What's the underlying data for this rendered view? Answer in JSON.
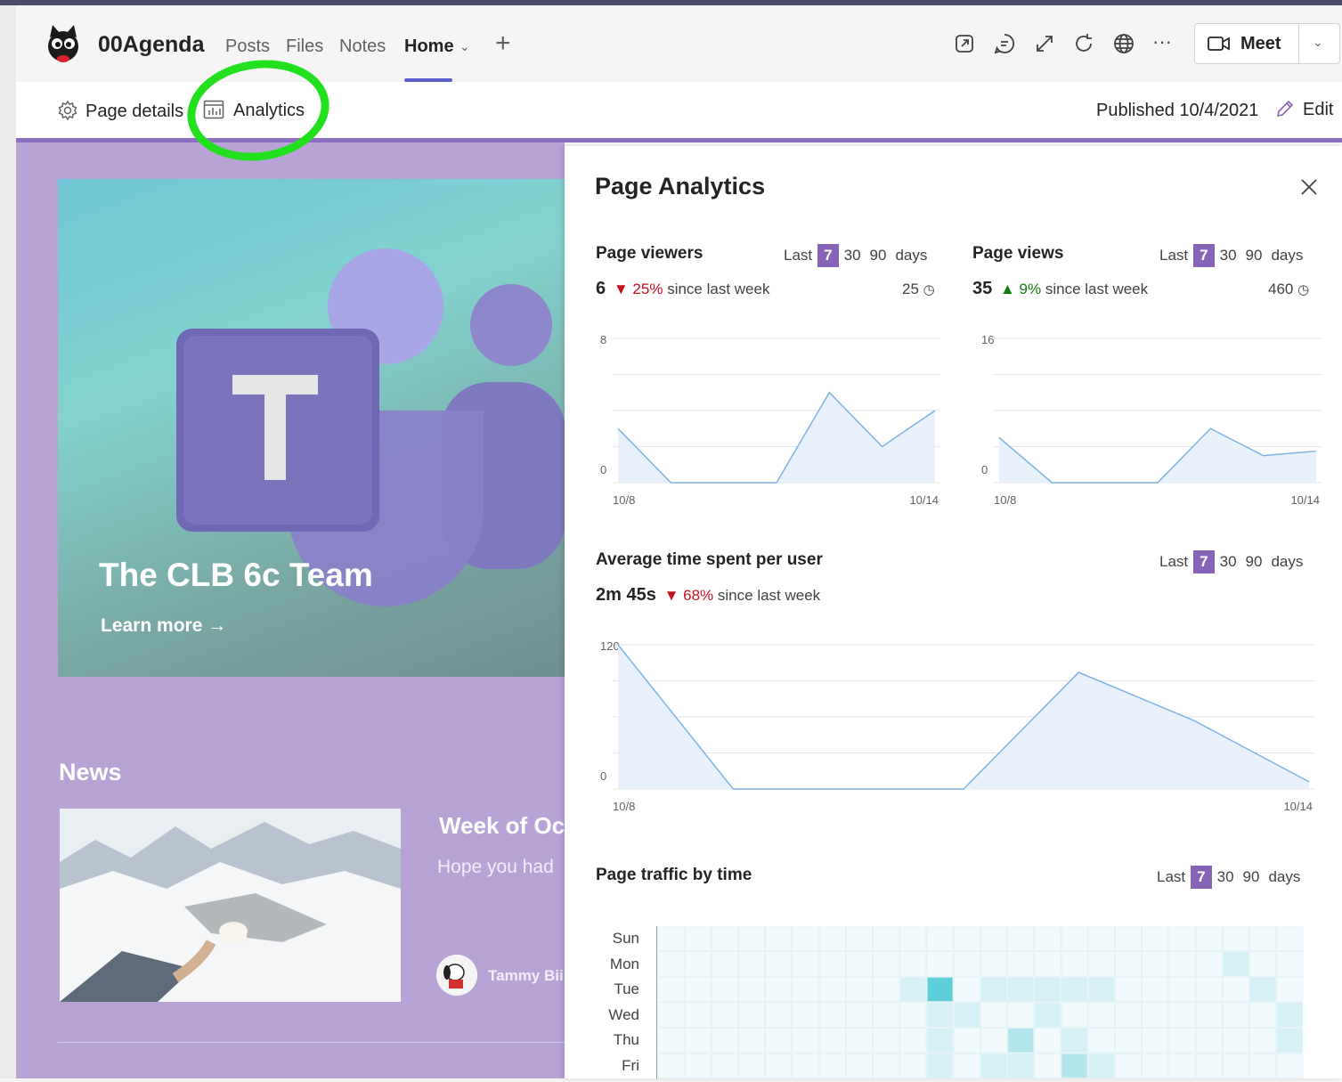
{
  "app": {
    "team_name": "00Agenda",
    "tabs": [
      {
        "label": "Posts"
      },
      {
        "label": "Files"
      },
      {
        "label": "Notes"
      },
      {
        "label": "Home",
        "active": true
      }
    ],
    "meet_label": "Meet"
  },
  "toolbar": {
    "page_details_label": "Page details",
    "analytics_label": "Analytics",
    "published_label": "Published 10/4/2021",
    "edit_label": "Edit"
  },
  "page": {
    "hero_title": "The CLB 6c Team",
    "hero_link": "Learn more",
    "news_heading": "News",
    "news_item": {
      "title": "Week of Oc",
      "description": "Hope you had",
      "author": "Tammy Bii"
    }
  },
  "analytics": {
    "title": "Page Analytics",
    "range_label": "Last",
    "range_options": [
      "7",
      "30",
      "90"
    ],
    "range_unit": "days",
    "page_viewers": {
      "title": "Page viewers",
      "value": "6",
      "trend": "down",
      "change": "25%",
      "since": "since last week",
      "total": "25"
    },
    "page_views": {
      "title": "Page views",
      "value": "35",
      "trend": "up",
      "change": "9%",
      "since": "since last week",
      "total": "460"
    },
    "avg_time": {
      "title": "Average time spent per user",
      "value": "2m 45s",
      "trend": "down",
      "change": "68%",
      "since": "since last week"
    },
    "traffic": {
      "title": "Page traffic by time",
      "days": [
        "Sun",
        "Mon",
        "Tue",
        "Wed",
        "Thu",
        "Fri"
      ]
    }
  },
  "chart_data": [
    {
      "type": "area",
      "x": [
        "10/8",
        "10/9",
        "10/10",
        "10/11",
        "10/12",
        "10/13",
        "10/14"
      ],
      "xticks": [
        "10/8",
        "10/14"
      ],
      "values": [
        3,
        0,
        0,
        0,
        5,
        2,
        4
      ],
      "ylim": [
        0,
        8
      ],
      "yticks": [
        "8",
        "0"
      ]
    },
    {
      "type": "area",
      "x": [
        "10/8",
        "10/9",
        "10/10",
        "10/11",
        "10/12",
        "10/13",
        "10/14"
      ],
      "xticks": [
        "10/8",
        "10/14"
      ],
      "values": [
        5,
        0,
        0,
        0,
        6,
        3,
        3.5
      ],
      "ylim": [
        0,
        16
      ],
      "yticks": [
        "16",
        "0"
      ]
    },
    {
      "type": "area",
      "x": [
        "10/8",
        "10/9",
        "10/10",
        "10/11",
        "10/12",
        "10/13",
        "10/14"
      ],
      "xticks": [
        "10/8",
        "10/14"
      ],
      "values": [
        120,
        0,
        0,
        0,
        97,
        57,
        6
      ],
      "ylim": [
        0,
        120
      ],
      "yticks": [
        "120",
        "0"
      ]
    },
    {
      "type": "heatmap",
      "rows": [
        "Sun",
        "Mon",
        "Tue",
        "Wed",
        "Thu",
        "Fri"
      ],
      "columns": 24,
      "levels": [
        [
          0,
          0,
          0,
          0,
          0,
          0,
          0,
          0,
          0,
          0,
          0,
          0,
          0,
          0,
          0,
          0,
          0,
          0,
          0,
          0,
          0,
          0,
          0,
          0
        ],
        [
          0,
          0,
          0,
          0,
          0,
          0,
          0,
          0,
          0,
          0,
          0,
          0,
          0,
          0,
          0,
          0,
          0,
          0,
          0,
          0,
          0,
          1,
          0,
          0
        ],
        [
          0,
          0,
          0,
          0,
          0,
          0,
          0,
          0,
          0,
          1,
          3,
          0,
          1,
          1,
          1,
          1,
          1,
          0,
          0,
          0,
          0,
          0,
          1,
          0
        ],
        [
          0,
          0,
          0,
          0,
          0,
          0,
          0,
          0,
          0,
          0,
          1,
          1,
          0,
          0,
          1,
          0,
          0,
          0,
          0,
          0,
          0,
          0,
          0,
          1
        ],
        [
          0,
          0,
          0,
          0,
          0,
          0,
          0,
          0,
          0,
          0,
          1,
          0,
          0,
          2,
          0,
          1,
          0,
          0,
          0,
          0,
          0,
          0,
          0,
          1
        ],
        [
          0,
          0,
          0,
          0,
          0,
          0,
          0,
          0,
          0,
          0,
          1,
          0,
          1,
          1,
          0,
          2,
          1,
          0,
          0,
          0,
          0,
          0,
          0,
          0
        ]
      ]
    }
  ]
}
